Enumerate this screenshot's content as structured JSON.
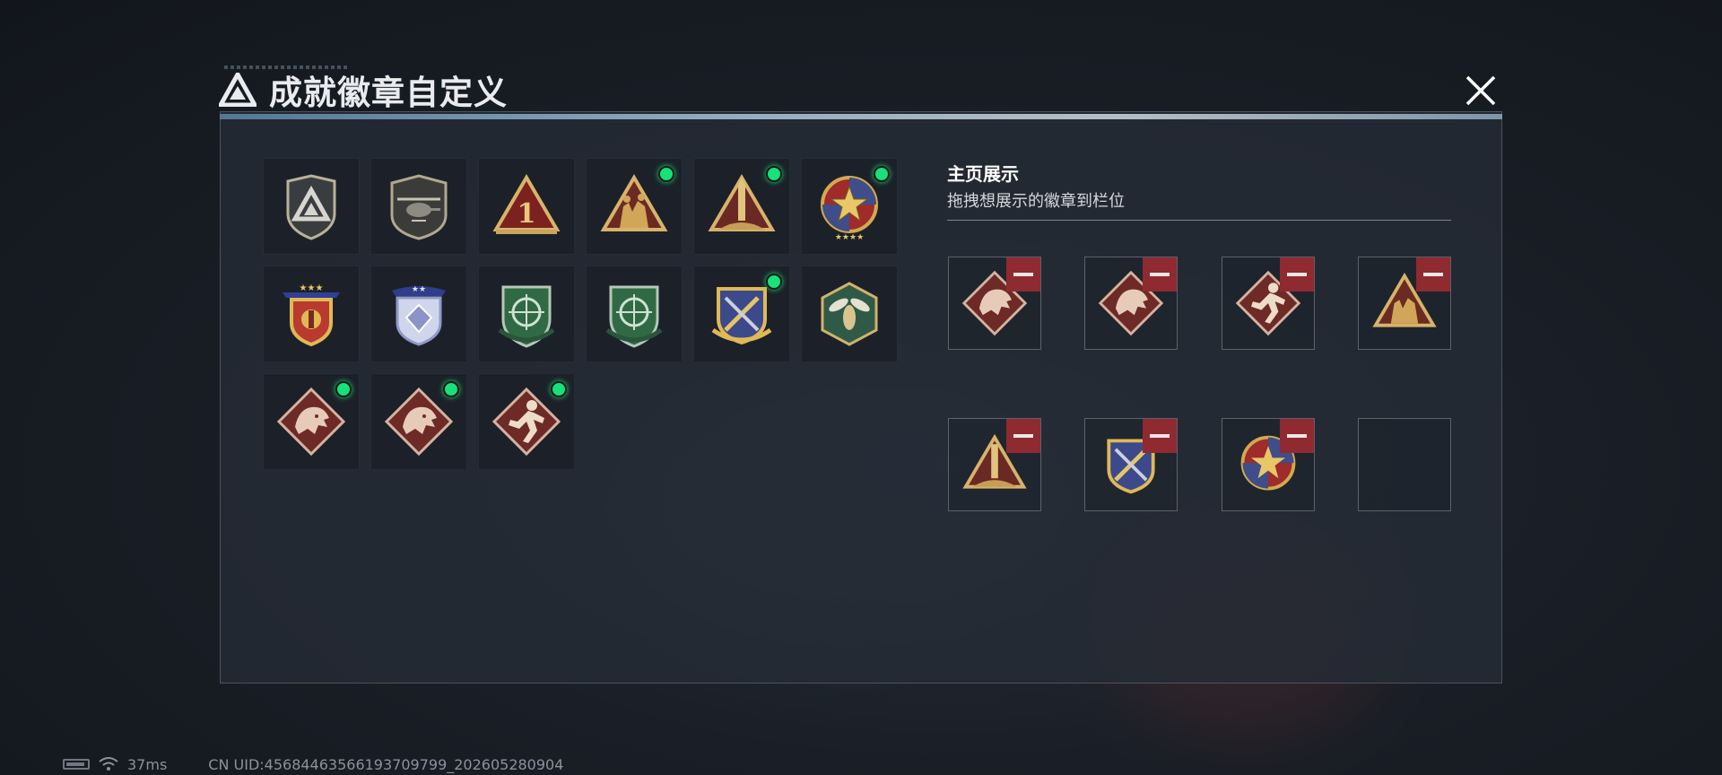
{
  "header": {
    "title": "成就徽章自定义",
    "logo_icon": "triangle-logo-icon",
    "close_icon": "close-icon"
  },
  "badges": [
    {
      "name": "silver-triangle-shield-badge",
      "new": false
    },
    {
      "name": "helicopter-shield-badge",
      "new": false
    },
    {
      "name": "red-triangle-number-one-badge",
      "new": false
    },
    {
      "name": "soldiers-triangle-badge",
      "new": true
    },
    {
      "name": "rocket-triangle-badge",
      "new": true
    },
    {
      "name": "star-round-emblem-badge",
      "new": true
    },
    {
      "name": "gold-stars-shield-badge",
      "new": false
    },
    {
      "name": "blue-diamond-shield-badge",
      "new": false
    },
    {
      "name": "green-crosshair-shield-badge",
      "new": false
    },
    {
      "name": "green-crosshair-shield-badge-2",
      "new": false
    },
    {
      "name": "gold-swords-shield-badge",
      "new": true
    },
    {
      "name": "hornet-hexagon-badge",
      "new": false
    },
    {
      "name": "dragon-diamond-badge",
      "new": true
    },
    {
      "name": "dragon-diamond-badge-2",
      "new": true
    },
    {
      "name": "runner-diamond-badge",
      "new": true
    }
  ],
  "display": {
    "title": "主页展示",
    "subtitle": "拖拽想展示的徽章到栏位",
    "slots": [
      {
        "badge": "dragon-diamond-badge"
      },
      {
        "badge": "dragon-diamond-badge-2"
      },
      {
        "badge": "runner-diamond-badge"
      },
      {
        "badge": "soldiers-triangle-badge"
      },
      {
        "badge": "rocket-triangle-badge"
      },
      {
        "badge": "gold-swords-shield-badge"
      },
      {
        "badge": "star-round-emblem-badge"
      },
      {
        "badge": ""
      }
    ],
    "remove_icon": "minus-icon"
  },
  "status_bar": {
    "ping": "37ms",
    "uid": "CN UID:4568446356619370979​9_202605280904"
  },
  "colors": {
    "new_dot": "#18e07a",
    "remove_button": "#8e2a30",
    "panel_border": "#4b535e"
  }
}
